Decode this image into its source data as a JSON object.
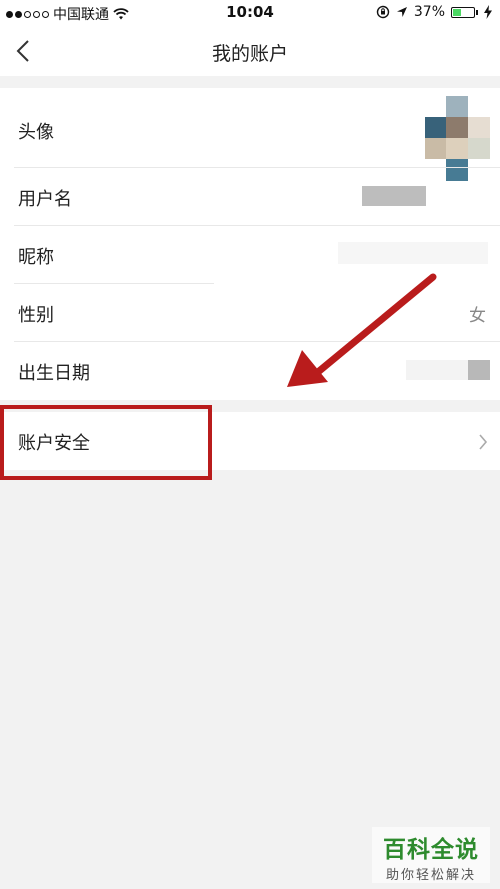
{
  "status_bar": {
    "carrier": "中国联通",
    "time": "10:04",
    "battery": "37%",
    "battery_level": 0.37,
    "icons": [
      "signal-dots-icon",
      "wifi-icon",
      "rotation-lock-icon",
      "location-arrow-icon",
      "battery-icon",
      "charging-bolt-icon"
    ]
  },
  "nav": {
    "title": "我的账户",
    "back_icon": "chevron-left-icon"
  },
  "profile": {
    "avatar_label": "头像",
    "username_label": "用户名",
    "nickname_label": "昵称",
    "gender_label": "性别",
    "gender_value": "女",
    "birthday_label": "出生日期"
  },
  "security": {
    "label": "账户安全",
    "chevron_icon": "chevron-right-icon"
  },
  "annotation": {
    "color": "#b91c1c"
  },
  "watermark": {
    "title": "百科全说",
    "subtitle": "助你轻松解决"
  }
}
